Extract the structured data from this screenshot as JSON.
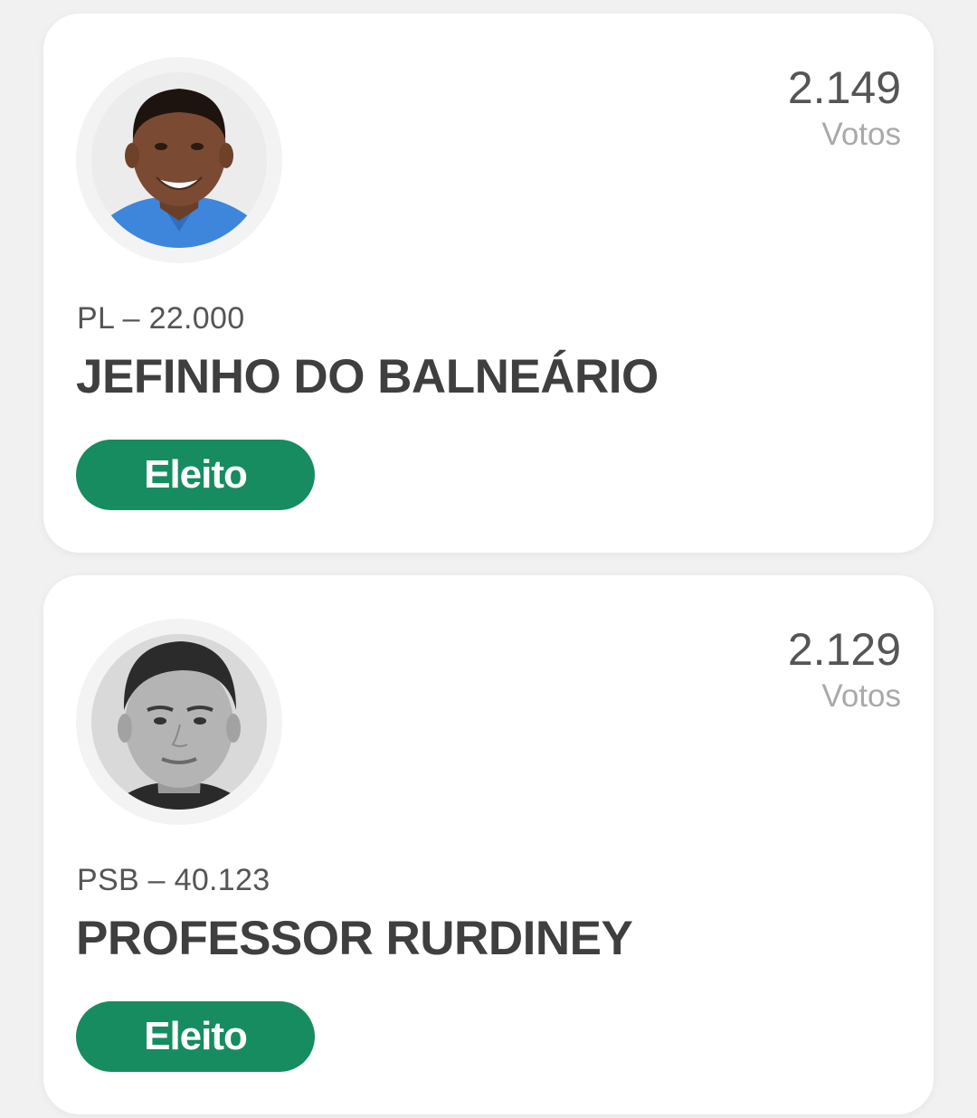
{
  "candidates": [
    {
      "party_number": "PL – 22.000",
      "name": "JEFINHO DO BALNEÁRIO",
      "votes": "2.149",
      "votes_label": "Votos",
      "status": "Eleito"
    },
    {
      "party_number": "PSB – 40.123",
      "name": "PROFESSOR RURDINEY",
      "votes": "2.129",
      "votes_label": "Votos",
      "status": "Eleito"
    }
  ],
  "colors": {
    "status_elected": "#168c60",
    "card_background": "#ffffff",
    "page_background": "#f1f1f1"
  }
}
